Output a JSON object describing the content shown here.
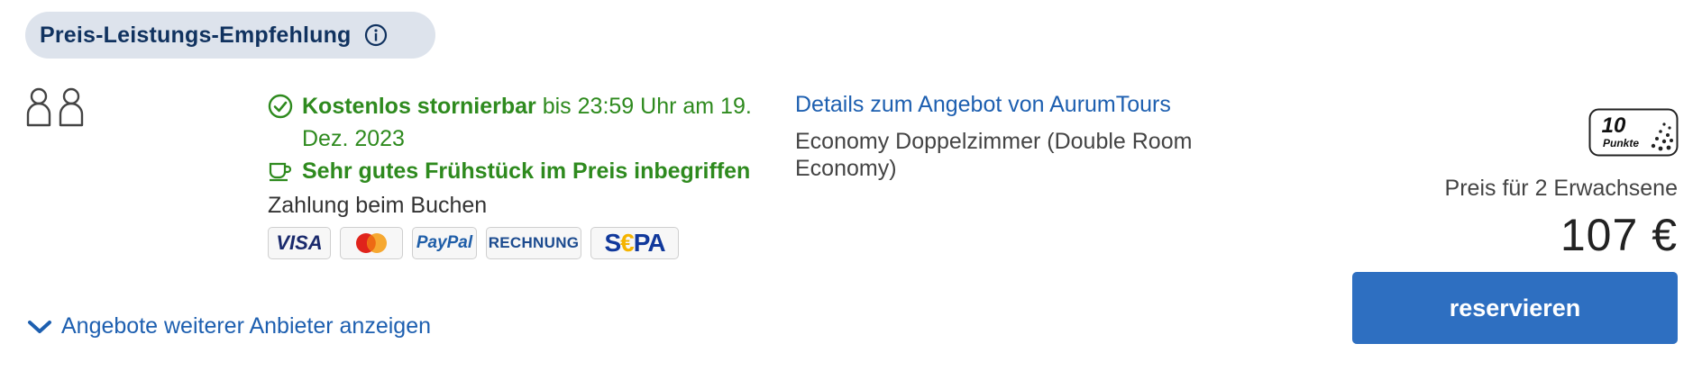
{
  "badge": {
    "label": "Preis-Leistungs-Empfehlung",
    "icon": "info-icon"
  },
  "guests": {
    "icons": [
      "person-icon",
      "person-icon"
    ]
  },
  "terms": {
    "cancellation_bold": "Kostenlos stornierbar",
    "cancellation_rest": " bis 23:59 Uhr am 19. Dez. 2023",
    "breakfast": "Sehr gutes Frühstück im Preis inbegriffen",
    "payment": "Zahlung beim Buchen",
    "accent_color": "#2e8a1e"
  },
  "payment_methods": {
    "visa": "VISA",
    "mastercard": "mastercard-logo",
    "paypal": "PayPal",
    "rechnung": "RECHNUNG",
    "sepa_s": "S",
    "sepa_euro": "€",
    "sepa_pa": "PA"
  },
  "details": {
    "link": "Details zum Angebot von AurumTours",
    "room": "Economy Doppelzimmer (Double Room Economy)"
  },
  "points": {
    "value": "10",
    "label": "Punkte"
  },
  "price": {
    "label": "Preis für 2 Erwachsene",
    "amount": "107 €"
  },
  "actions": {
    "reserve": "reservieren",
    "reserve_color": "#2e6fc1",
    "more_offers": "Angebote weiterer Anbieter anzeigen"
  }
}
